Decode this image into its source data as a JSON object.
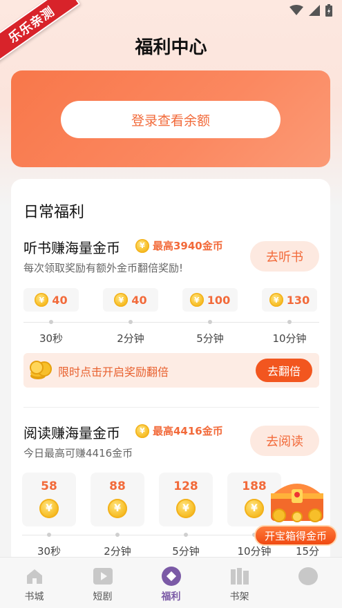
{
  "ribbon": "乐乐亲测",
  "header": {
    "title": "福利中心"
  },
  "balance": {
    "login_label": "登录查看余额"
  },
  "daily": {
    "section_title": "日常福利",
    "listen": {
      "title": "听书赚海量金币",
      "max": "最高3940金币",
      "subtitle": "每次领取奖励有额外金币翻倍奖励!",
      "button": "去听书",
      "rewards": [
        "40",
        "40",
        "100",
        "130"
      ],
      "times": [
        "30秒",
        "2分钟",
        "5分钟",
        "10分钟"
      ],
      "double_text": "限时点击开启奖励翻倍",
      "double_button": "去翻倍"
    },
    "read": {
      "title": "阅读赚海量金币",
      "max": "最高4416金币",
      "subtitle": "今日最高可赚4416金币",
      "button": "去阅读",
      "rewards": [
        "58",
        "88",
        "128",
        "188"
      ],
      "times": [
        "30秒",
        "2分钟",
        "5分钟",
        "10分钟",
        "15分"
      ]
    }
  },
  "treasure": {
    "label": "开宝箱得金币"
  },
  "nav": {
    "items": [
      {
        "label": "书城",
        "icon": "home-icon"
      },
      {
        "label": "短剧",
        "icon": "play-icon"
      },
      {
        "label": "福利",
        "icon": "welfare-icon",
        "active": true
      },
      {
        "label": "书架",
        "icon": "bookshelf-icon"
      },
      {
        "label": "",
        "icon": "profile-icon"
      }
    ]
  },
  "colors": {
    "accent": "#f26a3a",
    "active_nav": "#7b5aa6"
  }
}
